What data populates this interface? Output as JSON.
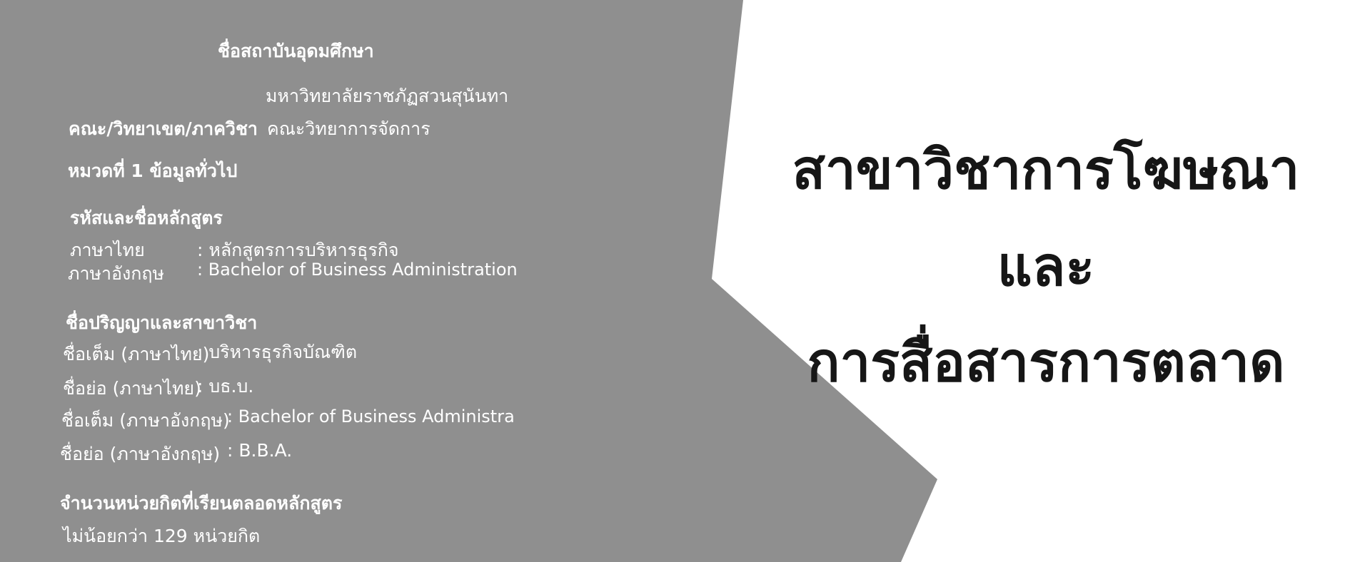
{
  "colors": {
    "panel": "#8f8f8f",
    "text_light": "#ffffff",
    "title": "#161616",
    "background": "#ffffff"
  },
  "institution": {
    "heading": "ชื่อสถาบันอุดมศึกษา",
    "name": "มหาวิทยาลัยราชภัฏสวนสุนันทา",
    "faculty_label": "คณะ/วิทยาเขต/ภาควิชา",
    "faculty_value": "คณะวิทยาการจัดการ"
  },
  "section": {
    "title": "หมวดที่ 1 ข้อมูลทั่วไป"
  },
  "curriculum": {
    "heading": "รหัสและชื่อหลักสูตร",
    "rows": [
      {
        "label": "ภาษาไทย",
        "value": ": หลักสูตรการบริหารธุรกิจ"
      },
      {
        "label": "ภาษาอังกฤษ",
        "value": ": Bachelor of Business Administration"
      }
    ]
  },
  "degree": {
    "heading": "ชื่อปริญญาและสาขาวิชา",
    "rows": [
      {
        "label": "ชื่อเต็ม (ภาษาไทย)",
        "value": ": บริหารธุรกิจบัณฑิต"
      },
      {
        "label": "ชื่อย่อ (ภาษาไทย)",
        "value": ": บธ.บ."
      },
      {
        "label": "ชื่อเต็ม (ภาษาอังกฤษ)",
        "value": ": Bachelor of Business Administra"
      },
      {
        "label": "ชื่อย่อ (ภาษาอังกฤษ)",
        "value": ": B.B.A."
      }
    ]
  },
  "credits": {
    "heading": "จำนวนหน่วยกิตที่เรียนตลอดหลักสูตร",
    "value": "ไม่น้อยกว่า 129 หน่วยกิต"
  },
  "program_title": {
    "line1": "สาขาวิชาการโฆษณา",
    "line2": "และ",
    "line3": "การสื่อสารการตลาด"
  }
}
